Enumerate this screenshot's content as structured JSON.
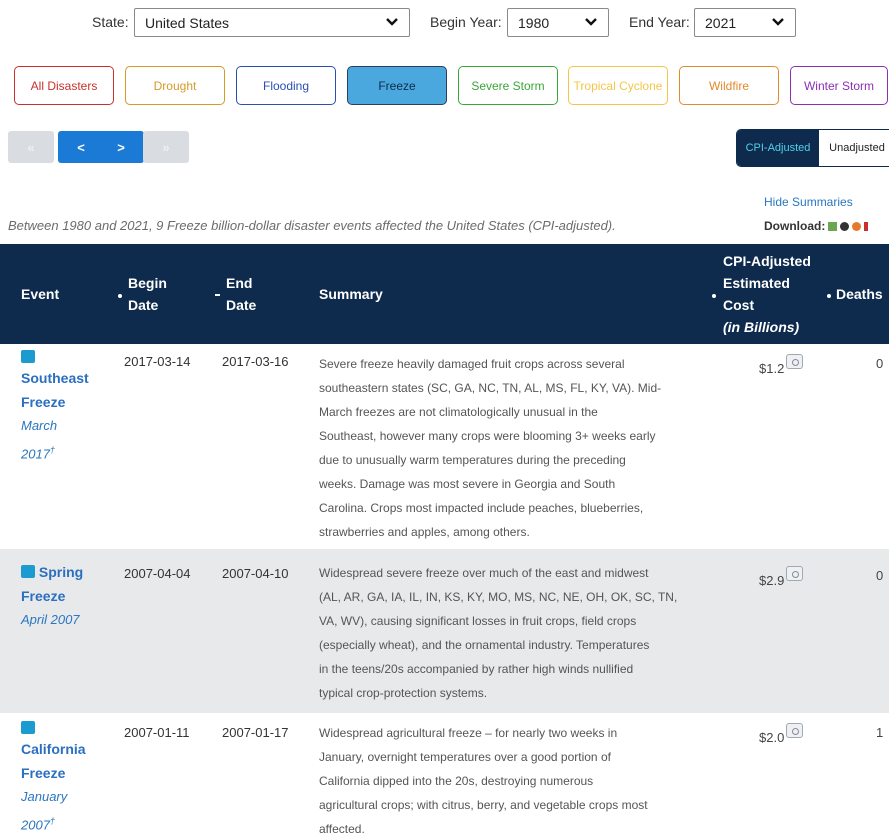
{
  "filters": {
    "state_label": "State:",
    "state_value": "United States",
    "begin_label": "Begin Year:",
    "begin_value": "1980",
    "end_label": "End Year:",
    "end_value": "2021"
  },
  "disaster_types": [
    {
      "label": "All Disasters",
      "color": "#c9302c"
    },
    {
      "label": "Drought",
      "color": "#d49a2a"
    },
    {
      "label": "Flooding",
      "color": "#2b4fb0"
    },
    {
      "label": "Freeze",
      "color": "#2a3f60"
    },
    {
      "label": "Severe Storm",
      "color": "#3aa63a"
    },
    {
      "label": "Tropical Cyclone",
      "color": "#f3c64a"
    },
    {
      "label": "Wildfire",
      "color": "#e38a2c"
    },
    {
      "label": "Winter Storm",
      "color": "#8b2fb7"
    }
  ],
  "active_type": "Freeze",
  "pager": {
    "first": "«",
    "prev": "<",
    "next": ">",
    "last": "»"
  },
  "toggle": {
    "cpi": "CPI-Adjusted",
    "unadjusted": "Unadjusted"
  },
  "hide_summaries": "Hide Summaries",
  "caption": "Between 1980 and 2021, 9 Freeze billion-dollar disaster events affected the United States (CPI-adjusted).",
  "download_label": "Download:",
  "table": {
    "headers": {
      "event": "Event",
      "begin_1": "Begin",
      "begin_2": "Date",
      "end_1": "End",
      "end_2": "Date",
      "summary": "Summary",
      "cost_1": "CPI-Adjusted",
      "cost_2": "Estimated",
      "cost_3": "Cost",
      "cost_4": "(in Billions)",
      "deaths": "Deaths"
    },
    "rows": [
      {
        "name_1": "Southeast",
        "name_2": "Freeze",
        "date_1": "March",
        "date_2": "2017",
        "dagger": "†",
        "begin": "2017-03-14",
        "end": "2017-03-16",
        "summary": [
          "Severe freeze heavily damaged fruit crops across several",
          "southeastern states (SC, GA, NC, TN, AL, MS, FL, KY, VA). Mid-",
          "March freezes are not climatologically unusual in the",
          "Southeast, however many crops were blooming 3+ weeks early",
          "due to unusually warm temperatures during the preceding",
          "weeks. Damage was most severe in Georgia and South",
          "Carolina. Crops most impacted include peaches, blueberries,",
          "strawberries and apples, among others."
        ],
        "cost": "$1.2",
        "deaths": "0"
      },
      {
        "name_1": "Spring",
        "name_2": "Freeze",
        "date_1": "April 2007",
        "date_2": "",
        "dagger": "",
        "begin": "2007-04-04",
        "end": "2007-04-10",
        "summary": [
          "Widespread severe freeze over much of the east and midwest",
          "(AL, AR, GA, IA, IL, IN, KS, KY, MO, MS, NC, NE, OH, OK, SC, TN,",
          "VA, WV), causing significant losses in fruit crops, field crops",
          "(especially wheat), and the ornamental industry. Temperatures",
          "in the teens/20s accompanied by rather high winds nullified",
          "typical crop-protection systems."
        ],
        "cost": "$2.9",
        "deaths": "0"
      },
      {
        "name_1": "California",
        "name_2": "Freeze",
        "date_1": "January",
        "date_2": "2007",
        "dagger": "†",
        "begin": "2007-01-11",
        "end": "2007-01-17",
        "summary": [
          "Widespread agricultural freeze – for nearly two weeks in",
          "January, overnight temperatures over a good portion of",
          "California dipped into the 20s, destroying numerous",
          "agricultural crops; with citrus, berry, and vegetable crops most",
          "affected."
        ],
        "cost": "$2.0",
        "deaths": "1"
      }
    ]
  },
  "colors": {
    "header_bg": "#0e2a4d",
    "link": "#2a6fc0",
    "event_square": "#1c9bd1",
    "active_button_bg": "#4aa8de",
    "alt_row": "#e8e9ea"
  }
}
